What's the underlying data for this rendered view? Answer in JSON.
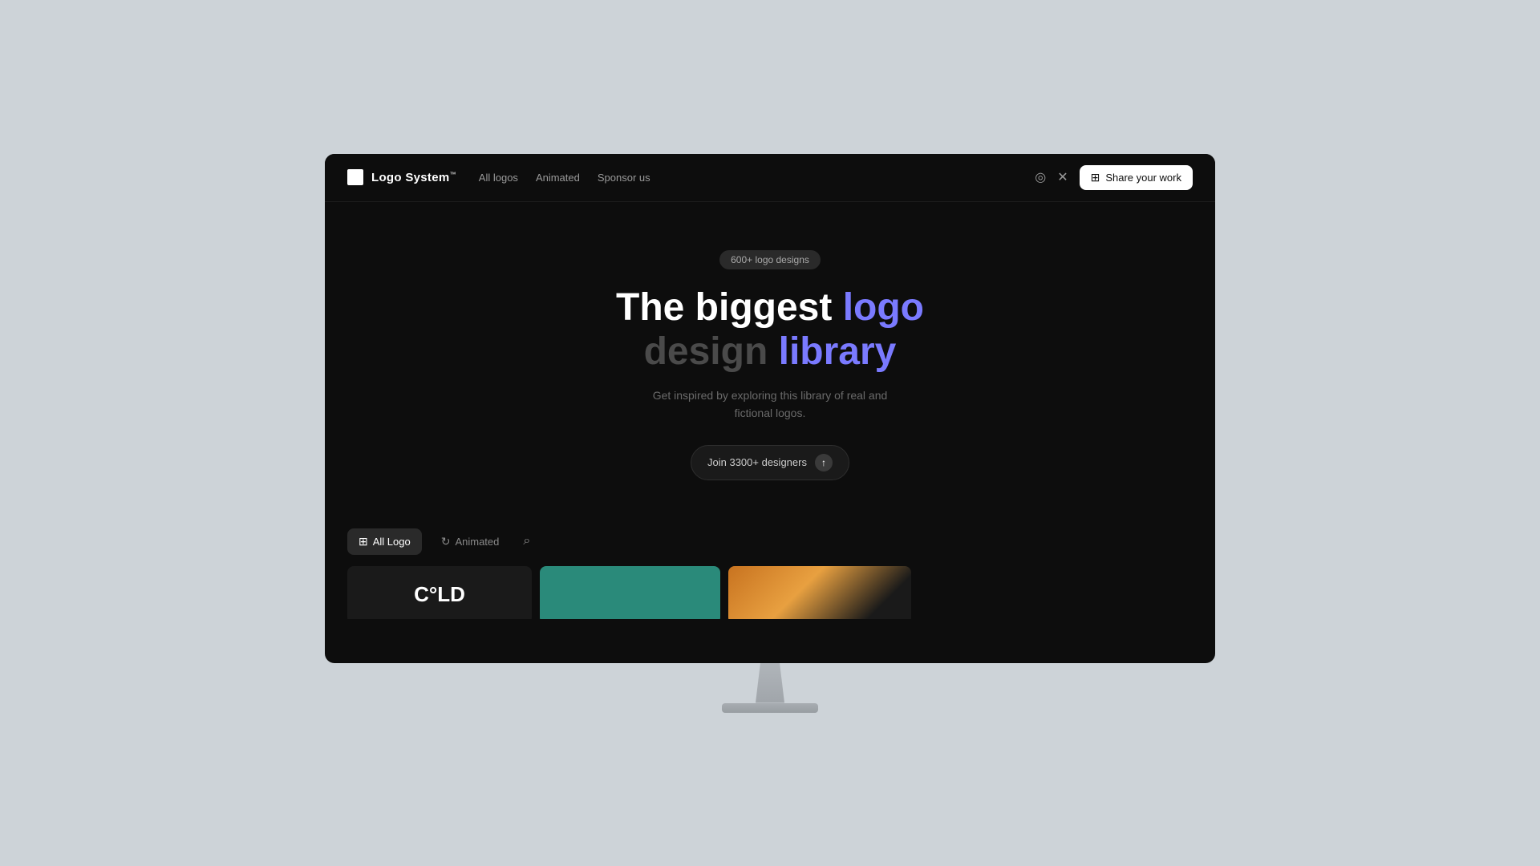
{
  "brand": {
    "logo_square": "■",
    "name": "Logo System",
    "trademark": "™"
  },
  "nav": {
    "links": [
      {
        "id": "all-logos",
        "label": "All logos"
      },
      {
        "id": "animated",
        "label": "Animated"
      },
      {
        "id": "sponsor",
        "label": "Sponsor us"
      }
    ],
    "social": [
      {
        "id": "instagram",
        "symbol": "◎"
      },
      {
        "id": "twitter-x",
        "symbol": "✕"
      }
    ],
    "share_button": "Share your work",
    "share_icon": "⊞"
  },
  "hero": {
    "badge": "600+ logo designs",
    "title_line1_white": "The biggest",
    "title_line1_accent": "logo",
    "title_line2_dark": "design",
    "title_line2_accent": "library",
    "subtitle": "Get inspired by exploring this library of real and fictional logos.",
    "cta_label": "Join 3300+ designers",
    "cta_arrow": "↑"
  },
  "filter": {
    "buttons": [
      {
        "id": "all-logo",
        "label": "All Logo",
        "icon": "⊞",
        "active": true
      },
      {
        "id": "animated",
        "label": "Animated",
        "icon": "↻",
        "active": false
      }
    ],
    "search_icon": "🔍"
  },
  "gallery": {
    "cards": [
      {
        "id": "card-dark",
        "type": "dark",
        "text": "C°LD"
      },
      {
        "id": "card-teal",
        "type": "teal"
      },
      {
        "id": "card-photo",
        "type": "photo"
      }
    ]
  }
}
